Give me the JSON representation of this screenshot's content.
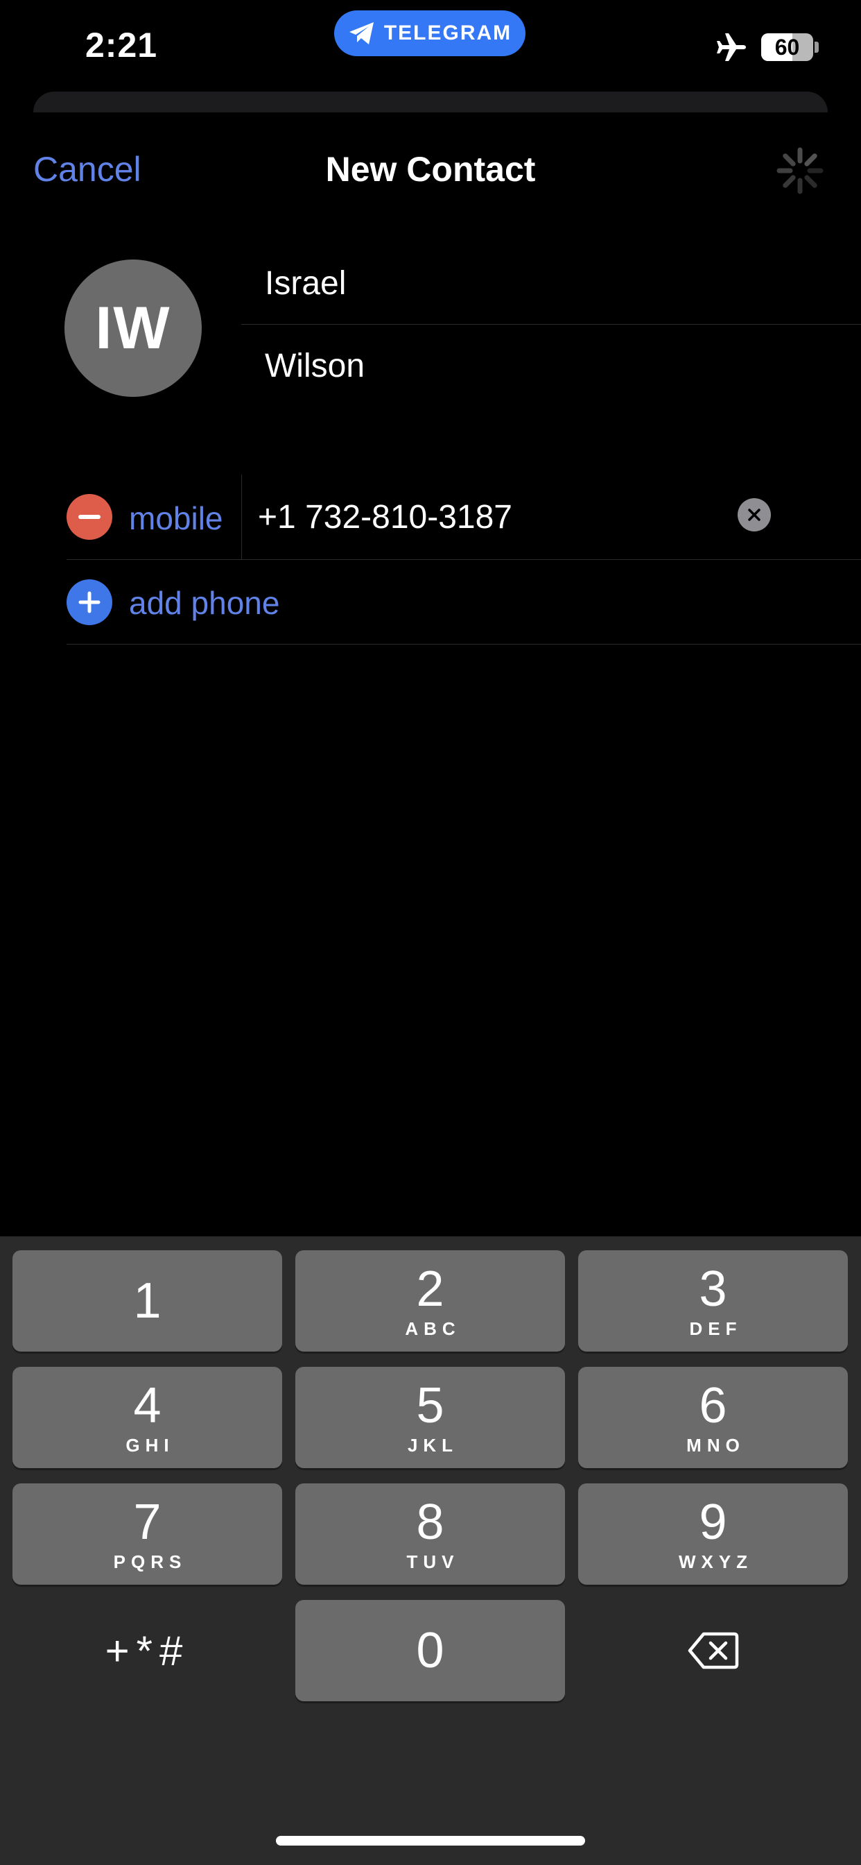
{
  "status_bar": {
    "time": "2:21",
    "app_pill": "TELEGRAM",
    "battery_percent": 60,
    "battery_label": "60"
  },
  "nav": {
    "cancel_label": "Cancel",
    "title": "New Contact"
  },
  "contact": {
    "initials": "IW",
    "first_name": "Israel",
    "last_name": "Wilson"
  },
  "phones": [
    {
      "label": "mobile",
      "value": "+1 732-810-3187"
    }
  ],
  "add_phone_label": "add phone",
  "keypad": {
    "keys": [
      {
        "digit": "1",
        "letters": ""
      },
      {
        "digit": "2",
        "letters": "ABC"
      },
      {
        "digit": "3",
        "letters": "DEF"
      },
      {
        "digit": "4",
        "letters": "GHI"
      },
      {
        "digit": "5",
        "letters": "JKL"
      },
      {
        "digit": "6",
        "letters": "MNO"
      },
      {
        "digit": "7",
        "letters": "PQRS"
      },
      {
        "digit": "8",
        "letters": "TUV"
      },
      {
        "digit": "9",
        "letters": "WXYZ"
      },
      {
        "digit": "0",
        "letters": ""
      }
    ],
    "symbols_label": "+*#"
  },
  "colors": {
    "accent": "#6183e8",
    "delete_red": "#de5c4a",
    "add_blue": "#3f77e8",
    "telegram_blue": "#3478f6"
  },
  "icons": [
    "telegram-icon",
    "airplane-icon",
    "battery-icon",
    "spinner-icon",
    "minus-circle-icon",
    "plus-circle-icon",
    "clear-icon",
    "backspace-icon"
  ]
}
